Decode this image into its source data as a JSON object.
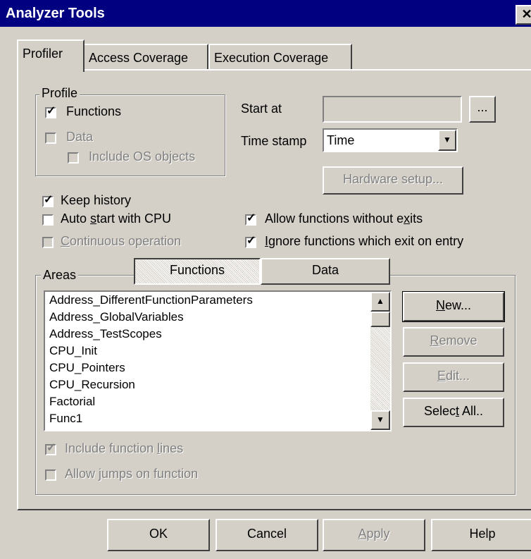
{
  "window": {
    "title": "Analyzer Tools",
    "close_glyph": "✕"
  },
  "tabs": [
    {
      "label": "Profiler"
    },
    {
      "label": "Access Coverage"
    },
    {
      "label": "Execution Coverage"
    }
  ],
  "profile_group": {
    "label": "Profile",
    "functions": {
      "label": "Functions",
      "checked": true
    },
    "data": {
      "label": "Data",
      "checked": false,
      "disabled": true
    },
    "include_os": {
      "label": "Include OS objects",
      "checked": false,
      "disabled": true
    }
  },
  "start_at": {
    "label": "Start at",
    "value": "",
    "browse_label": "..."
  },
  "time_stamp": {
    "label": "Time stamp",
    "value": "Time"
  },
  "hardware_setup_label": "Hardware setup...",
  "options": {
    "keep_history": {
      "label": "Keep history",
      "checked": true
    },
    "auto_start": {
      "label_pre": "Auto ",
      "label_u": "s",
      "label_post": "tart with CPU",
      "checked": false
    },
    "continuous": {
      "label_u": "C",
      "label_post": "ontinuous operation",
      "checked": false,
      "disabled": true
    },
    "allow_no_exits": {
      "label_pre": "Allow functions without e",
      "label_u": "x",
      "label_post": "its",
      "checked": true
    },
    "ignore_exit": {
      "label_u": "I",
      "label_post": "gnore functions which exit on entry",
      "checked": true
    }
  },
  "areas": {
    "label": "Areas",
    "tab_functions": "Functions",
    "tab_data": "Data",
    "items": [
      "Address_DifferentFunctionParameters",
      "Address_GlobalVariables",
      "Address_TestScopes",
      "CPU_Init",
      "CPU_Pointers",
      "CPU_Recursion",
      "Factorial",
      "Func1"
    ],
    "new_label_u": "N",
    "new_label_post": "ew...",
    "remove_label_u": "R",
    "remove_label_post": "emove",
    "edit_label_u": "E",
    "edit_label_post": "dit...",
    "select_all_pre": "Selec",
    "select_all_u": "t",
    "select_all_post": " All..",
    "include_lines": {
      "label_pre": "Include function ",
      "label_u": "l",
      "label_post": "ines",
      "checked": true,
      "disabled": true
    },
    "allow_jumps": {
      "label": "Allow jumps on function",
      "checked": false,
      "disabled": true
    }
  },
  "footer": {
    "ok": "OK",
    "cancel": "Cancel",
    "apply_u": "A",
    "apply_post": "pply",
    "help": "Help"
  },
  "colors": {
    "titlebar": "#000080",
    "face": "#d4d0c8",
    "disabled_text": "#808080"
  }
}
